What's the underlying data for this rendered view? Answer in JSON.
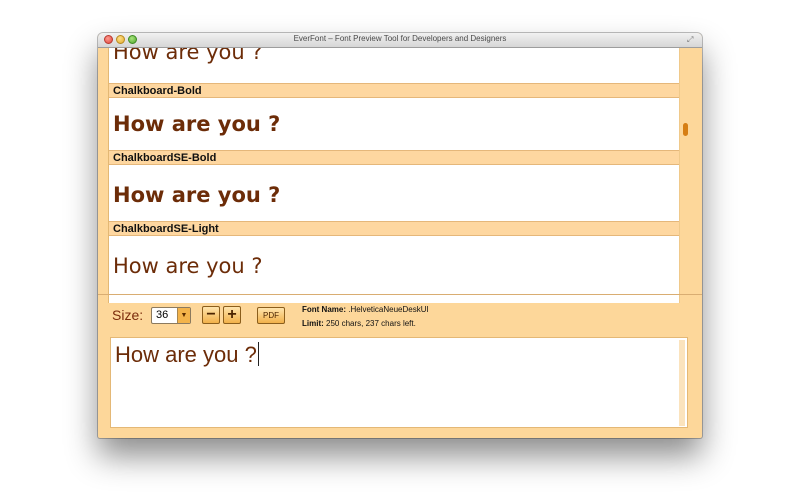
{
  "window": {
    "title": "EverFont – Font Preview Tool for Developers and Designers"
  },
  "preview": {
    "fonts": [
      {
        "name": "",
        "sample": "How are you ?",
        "weight": "normal"
      },
      {
        "name": "Chalkboard-Bold",
        "sample": "How are you ?",
        "weight": "bold"
      },
      {
        "name": "ChalkboardSE-Bold",
        "sample": "How are you ?",
        "weight": "bold"
      },
      {
        "name": "ChalkboardSE-Light",
        "sample": "How are you ?",
        "weight": "normal"
      }
    ]
  },
  "controls": {
    "size_label": "Size:",
    "size_value": "36",
    "minus_label": "−",
    "plus_label": "+",
    "pdf_label": "PDF",
    "font_name_label": "Font Name:",
    "font_name_value": ".HelveticaNeueDeskUI",
    "limit_label": "Limit:",
    "limit_value": "250 chars, 237 chars left."
  },
  "editor": {
    "text": "How are you ?"
  },
  "colors": {
    "window_bg": "#fdd79a",
    "header_bg": "#fed7a0",
    "sample_text": "#6c2c08",
    "scroll_thumb": "#d67e14"
  }
}
